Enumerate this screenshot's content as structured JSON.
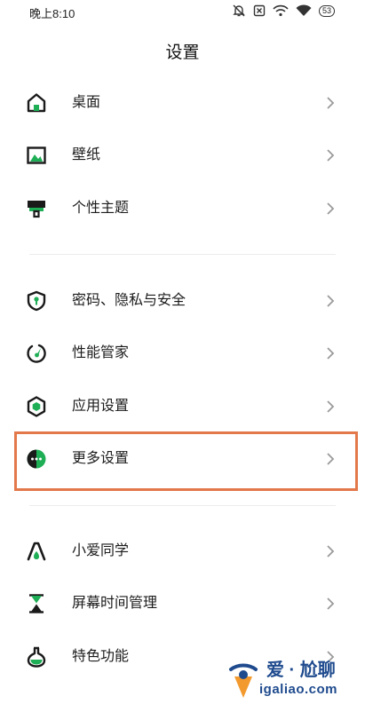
{
  "status_bar": {
    "time": "晚上8:10",
    "battery": "53",
    "icons": [
      "alarm-off-icon",
      "sim-off-icon",
      "hotspot-wifi-icon",
      "wifi-icon",
      "battery-icon"
    ]
  },
  "header": {
    "title": "设置"
  },
  "colors": {
    "accent": "#1eae55",
    "highlight": "#e3794b",
    "watermark": "#1f4b8e"
  },
  "groups": [
    {
      "items": [
        {
          "label": "桌面",
          "icon": "home-icon"
        },
        {
          "label": "壁纸",
          "icon": "wallpaper-icon"
        },
        {
          "label": "个性主题",
          "icon": "theme-icon"
        }
      ]
    },
    {
      "items": [
        {
          "label": "密码、隐私与安全",
          "icon": "shield-icon"
        },
        {
          "label": "性能管家",
          "icon": "gauge-icon"
        },
        {
          "label": "应用设置",
          "icon": "app-hexagon-icon"
        },
        {
          "label": "更多设置",
          "icon": "more-dots-icon"
        }
      ]
    },
    {
      "items": [
        {
          "label": "小爱同学",
          "icon": "assistant-icon"
        },
        {
          "label": "屏幕时间管理",
          "icon": "hourglass-icon"
        },
        {
          "label": "特色功能",
          "icon": "flask-icon"
        }
      ]
    }
  ],
  "watermark": {
    "brand": "爱 · 尬聊",
    "url": "igaliao.com"
  }
}
